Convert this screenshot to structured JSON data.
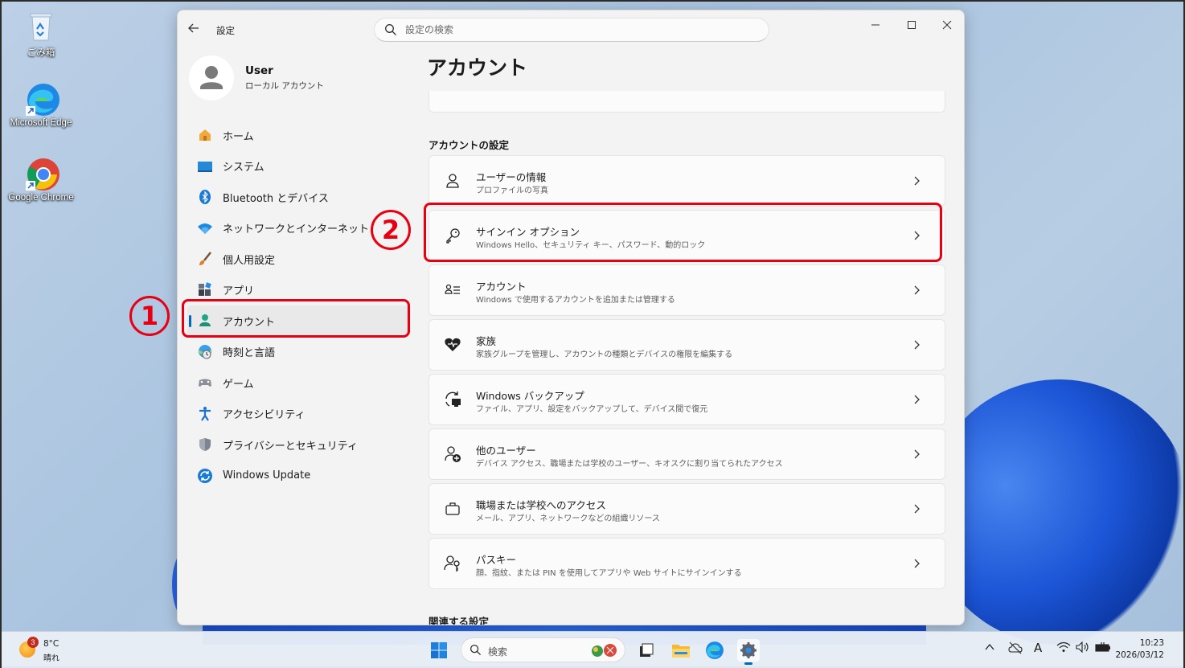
{
  "desktop": {
    "icons": [
      {
        "label": "ごみ箱"
      },
      {
        "label": "Microsoft Edge"
      },
      {
        "label": "Google Chrome"
      }
    ]
  },
  "window": {
    "title": "設定",
    "search_placeholder": "設定の検索",
    "profile": {
      "name": "User",
      "type": "ローカル アカウント"
    },
    "nav": [
      {
        "label": "ホーム",
        "icon": "home-icon"
      },
      {
        "label": "システム",
        "icon": "system-icon"
      },
      {
        "label": "Bluetooth とデバイス",
        "icon": "bluetooth-icon"
      },
      {
        "label": "ネットワークとインターネット",
        "icon": "wifi-icon"
      },
      {
        "label": "個人用設定",
        "icon": "brush-icon"
      },
      {
        "label": "アプリ",
        "icon": "apps-icon"
      },
      {
        "label": "アカウント",
        "icon": "account-icon",
        "active": true
      },
      {
        "label": "時刻と言語",
        "icon": "time-language-icon"
      },
      {
        "label": "ゲーム",
        "icon": "gamepad-icon"
      },
      {
        "label": "アクセシビリティ",
        "icon": "accessibility-icon"
      },
      {
        "label": "プライバシーとセキュリティ",
        "icon": "shield-icon"
      },
      {
        "label": "Windows Update",
        "icon": "windows-update-icon"
      }
    ],
    "page_title": "アカウント",
    "section_heading": "アカウントの設定",
    "cards": [
      {
        "title": "ユーザーの情報",
        "subtitle": "プロファイルの写真",
        "icon": "user-info-icon"
      },
      {
        "title": "サインイン オプション",
        "subtitle": "Windows Hello、セキュリティ キー、パスワード、動的ロック",
        "icon": "key-icon"
      },
      {
        "title": "アカウント",
        "subtitle": "Windows で使用するアカウントを追加または管理する",
        "icon": "accounts-list-icon"
      },
      {
        "title": "家族",
        "subtitle": "家族グループを管理し、アカウントの種類とデバイスの権限を編集する",
        "icon": "family-heart-icon"
      },
      {
        "title": "Windows バックアップ",
        "subtitle": "ファイル、アプリ、設定をバックアップして、デバイス間で復元",
        "icon": "backup-icon"
      },
      {
        "title": "他のユーザー",
        "subtitle": "デバイス アクセス、職場または学校のユーザー、キオスクに割り当てられたアクセス",
        "icon": "other-users-icon"
      },
      {
        "title": "職場または学校へのアクセス",
        "subtitle": "メール、アプリ、ネットワークなどの組織リソース",
        "icon": "briefcase-icon"
      },
      {
        "title": "パスキー",
        "subtitle": "顔、指紋、または PIN を使用してアプリや Web サイトにサインインする",
        "icon": "passkey-icon"
      }
    ],
    "related_heading": "関連する設定"
  },
  "annotations": {
    "step1": "1",
    "step2": "2",
    "color": "#e60012"
  },
  "taskbar": {
    "weather_badge": "3",
    "temperature": "8°C",
    "condition": "晴れ",
    "search_label": "検索",
    "tray_ime": "A",
    "time": "10:23",
    "date": "2026/03/12"
  },
  "colors": {
    "accent": "#0067c0",
    "window_bg": "#f3f3f3",
    "card_bg": "#fbfbfb"
  }
}
